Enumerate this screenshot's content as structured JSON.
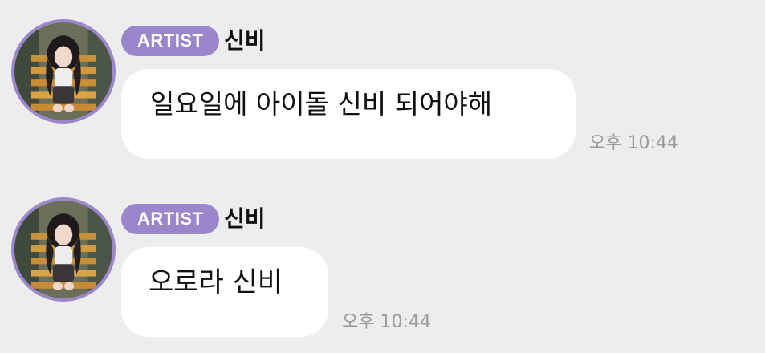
{
  "messages": [
    {
      "badge": "ARTIST",
      "sender": "신비",
      "text": "일요일에 아이돌 신비 되어야해",
      "time": "오후 10:44"
    },
    {
      "badge": "ARTIST",
      "sender": "신비",
      "text": "오로라 신비",
      "time": "오후 10:44"
    }
  ],
  "colors": {
    "background": "#ededed",
    "badge": "#9b86cb",
    "avatar_ring": "#9c87cd",
    "bubble": "#ffffff",
    "timestamp": "#9a9a9a"
  },
  "icons": {
    "avatar": "profile-photo-avatar"
  }
}
